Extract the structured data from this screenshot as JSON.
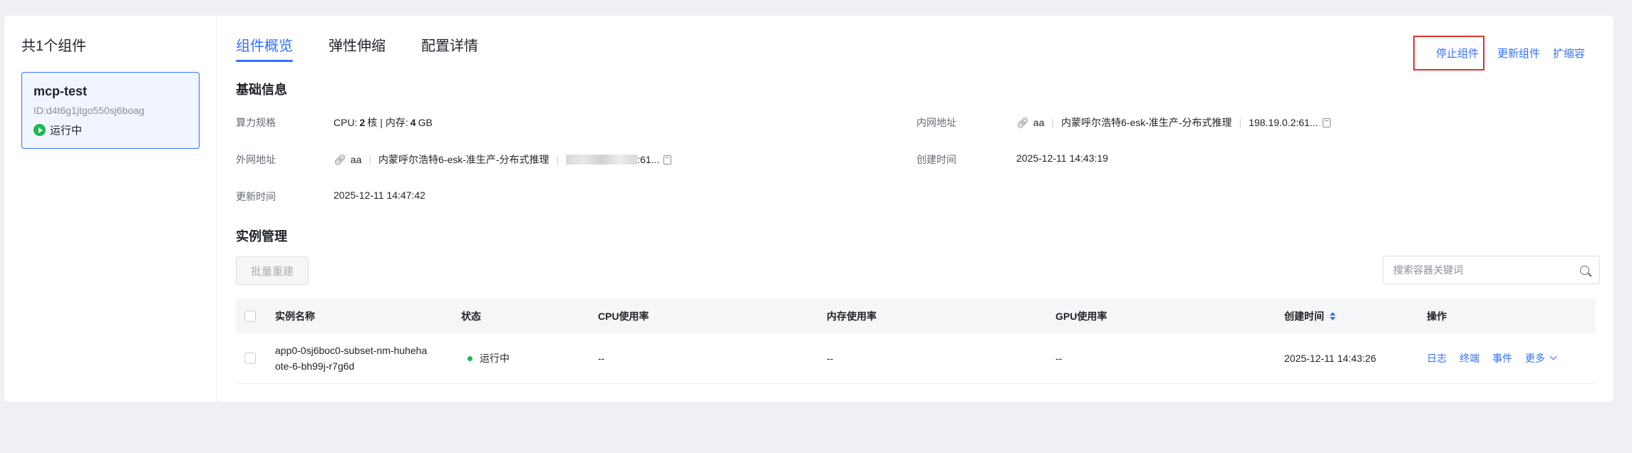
{
  "left": {
    "count_title": "共1个组件",
    "component": {
      "name": "mcp-test",
      "id": "ID:d4t6g1jtgo550sj6boag",
      "status": "运行中"
    }
  },
  "tabs": [
    "组件概览",
    "弹性伸缩",
    "配置详情"
  ],
  "actions": {
    "stop": "停止组件",
    "update": "更新组件",
    "scale": "扩缩容"
  },
  "basic": {
    "title": "基础信息",
    "spec_label": "算力规格",
    "spec": {
      "cpu_prefix": "CPU:",
      "cpu_value": "2",
      "cpu_unit": "核",
      "sep": "|",
      "mem_prefix": "内存:",
      "mem_value": "4",
      "mem_unit": "GB"
    },
    "intranet_label": "内网地址",
    "intranet": {
      "name": "aa",
      "region": "内蒙呼尔浩特6-esk-准生产-分布式推理",
      "addr": "198.19.0.2:61..."
    },
    "extranet_label": "外网地址",
    "extranet": {
      "name": "aa",
      "region": "内蒙呼尔浩特6-esk-准生产-分布式推理",
      "addr_suffix": ":61..."
    },
    "created_label": "创建时间",
    "created": "2025-12-11 14:43:19",
    "updated_label": "更新时间",
    "updated": "2025-12-11 14:47:42"
  },
  "instances": {
    "title": "实例管理",
    "batch_button": "批量重建",
    "search_placeholder": "搜索容器关键词",
    "columns": [
      "实例名称",
      "状态",
      "CPU使用率",
      "内存使用率",
      "GPU使用率",
      "创建时间",
      "操作"
    ],
    "rows": [
      {
        "name_line1": "app0-0sj6boc0-subset-nm-huheha",
        "name_line2": "ote-6-bh99j-r7g6d",
        "status": "运行中",
        "cpu": "--",
        "mem": "--",
        "gpu": "--",
        "created": "2025-12-11 14:43:26",
        "ops": [
          "日志",
          "终端",
          "事件",
          "更多"
        ]
      }
    ]
  },
  "colors": {
    "accent": "#3370ff",
    "running": "#1db954",
    "highlight_box": "#e5312b"
  },
  "icons": [
    "play-circle-icon",
    "link-icon",
    "copy-icon",
    "search-icon",
    "sort-icon",
    "chevron-down-icon"
  ]
}
